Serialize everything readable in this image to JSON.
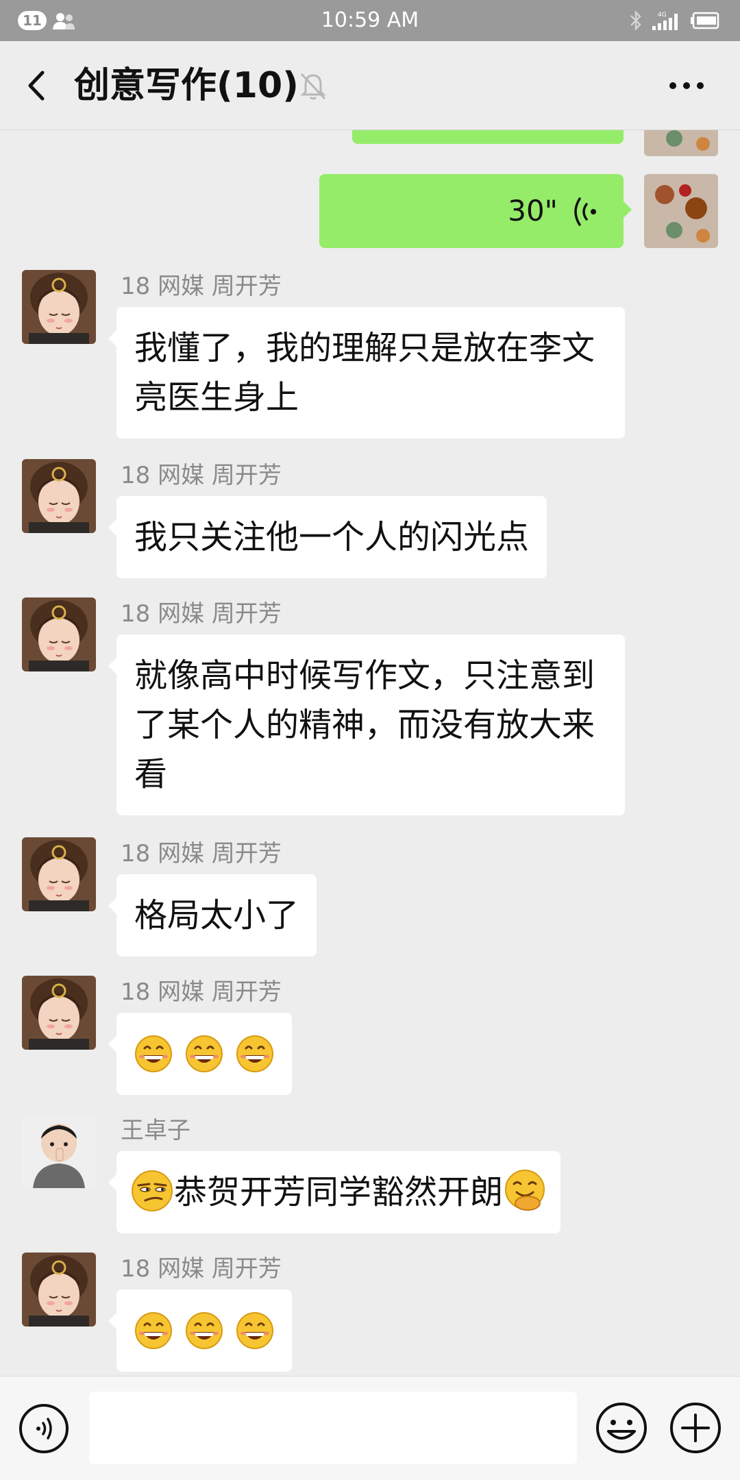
{
  "status_bar": {
    "notification_count": "11",
    "time": "10:59 AM",
    "network": "4G"
  },
  "header": {
    "title": "创意写作(10)"
  },
  "messages": [
    {
      "type": "voice_out",
      "duration": "30\""
    },
    {
      "sender": "18 网媒 周开芳",
      "text": "我懂了，我的理解只是放在李文亮医生身上"
    },
    {
      "sender": "18 网媒 周开芳",
      "text": "我只关注他一个人的闪光点"
    },
    {
      "sender": "18 网媒 周开芳",
      "text": "就像高中时候写作文，只注意到了某个人的精神，而没有放大来看"
    },
    {
      "sender": "18 网媒 周开芳",
      "text": "格局太小了"
    },
    {
      "sender": "18 网媒 周开芳",
      "emojis": [
        "grin",
        "grin",
        "grin"
      ]
    },
    {
      "sender": "王卓子",
      "text": "恭贺开芳同学豁然开朗",
      "emoji_before": "smirk",
      "emoji_after": "hand-over-mouth"
    },
    {
      "sender": "18 网媒 周开芳",
      "emojis": [
        "grin",
        "grin",
        "grin"
      ]
    }
  ],
  "input": {
    "placeholder": ""
  },
  "colors": {
    "background": "#ededed",
    "outgoing_bubble": "#95ec69",
    "incoming_bubble": "#ffffff",
    "status_bar": "#9a9a9a"
  }
}
